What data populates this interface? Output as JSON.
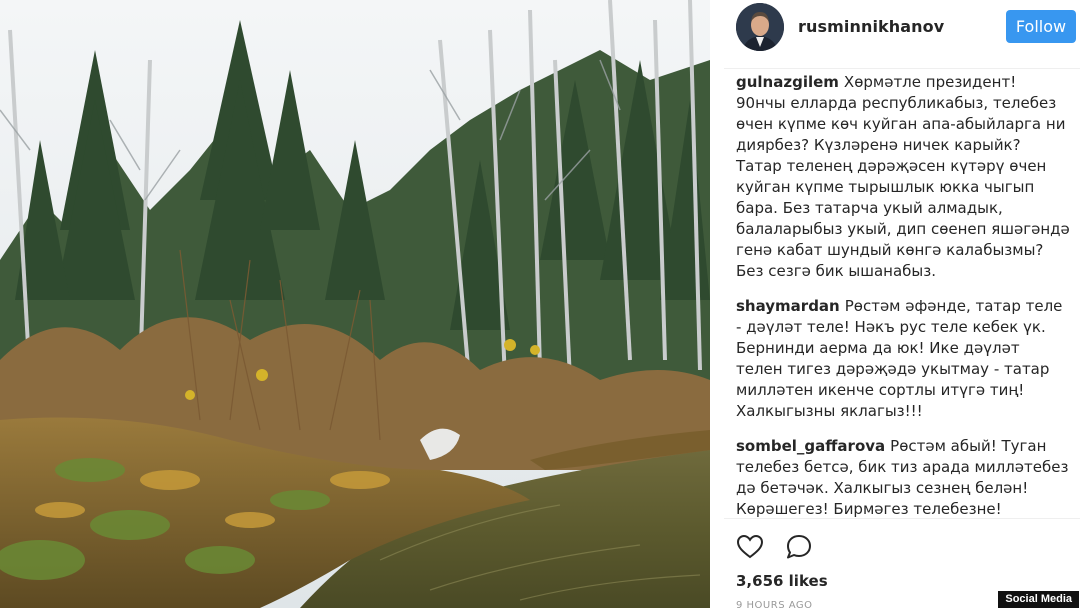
{
  "post": {
    "photo_description": ""
  },
  "header": {
    "username": "rusminnikhanov",
    "follow_label": "Follow"
  },
  "comments": [
    {
      "author": "gulnazgilem",
      "text": "Хөрмәтле президент! 90нчы елларда республикабыз, телебез өчен күпме көч куйган апа-абыйларга ни диярбез? Күзләренә ничек карыйк? Татар теленең дәрәҗәсен күтәрү өчен куйган күпме тырышлык юкка чыгып бара. Без татарча укый алмадык, балаларыбыз укый, дип сөенеп яшәгәндә генә кабат шундый көнгә калабызмы? Без сезгә бик ышанабыз."
    },
    {
      "author": "shaymardan",
      "text": "Рөстәм әфәнде, татар теле - дәүләт теле! Нәкъ рус теле кебек үк. Бернинди аерма да юк! Ике дәүләт телен тигез дәрәҗәдә укытмау - татар милләтен икенче сортлы итүгә тиң! Халкыгызны яклагыз!!!"
    },
    {
      "author": "sombel_gaffarova",
      "text": "Рөстәм абый! Туган телебез бетсә, бик тиз арада милләтебез дә бетәчәк. Халкыгыз сезнең белән! Көрәшегез! Бирмәгез телебезне!"
    }
  ],
  "actions": {
    "like_icon": "heart-outline-icon",
    "comment_icon": "speech-bubble-icon"
  },
  "likes": "3,656 likes",
  "time_ago": "9 HOURS AGO",
  "watermark": "Social Media",
  "colors": {
    "follow_button": "#3897f0",
    "text": "#262626",
    "muted": "#999999",
    "divider": "#efefef"
  }
}
